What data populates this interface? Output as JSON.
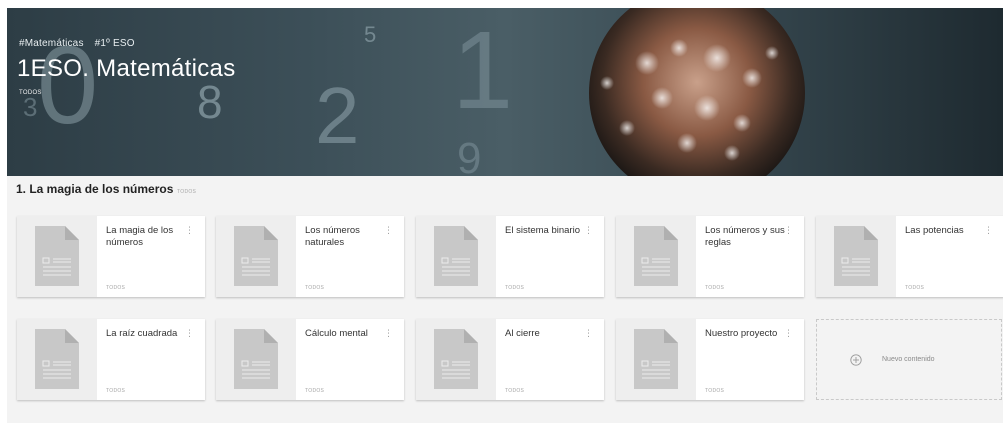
{
  "banner": {
    "tags": [
      "#Matemáticas",
      "#1º ESO"
    ],
    "title": "1ESO. Matemáticas",
    "audience": "TODOS",
    "decor_digits": [
      "0",
      "8",
      "5",
      "2",
      "1",
      "9",
      "3"
    ],
    "colors": {
      "background": "#2d3d45",
      "digits": "#8a9ea6"
    }
  },
  "section": {
    "title": "1. La magia de los números",
    "audience": "TODOS"
  },
  "cards": [
    {
      "title": "La magia de los números",
      "audience": "TODOS",
      "icon": "document-icon"
    },
    {
      "title": "Los números naturales",
      "audience": "TODOS",
      "icon": "document-icon"
    },
    {
      "title": "El sistema binario",
      "audience": "TODOS",
      "icon": "document-icon"
    },
    {
      "title": "Los números y sus reglas",
      "audience": "TODOS",
      "icon": "document-icon"
    },
    {
      "title": "Las potencias",
      "audience": "TODOS",
      "icon": "document-icon"
    },
    {
      "title": "La raíz cuadrada",
      "audience": "TODOS",
      "icon": "document-icon"
    },
    {
      "title": "Cálculo mental",
      "audience": "TODOS",
      "icon": "document-icon"
    },
    {
      "title": "Al cierre",
      "audience": "TODOS",
      "icon": "document-icon"
    },
    {
      "title": "Nuestro proyecto",
      "audience": "TODOS",
      "icon": "document-icon"
    }
  ],
  "new_content": {
    "label": "Nuevo contenido",
    "icon": "plus-circle-icon"
  },
  "card_menu_glyph": "⋮"
}
